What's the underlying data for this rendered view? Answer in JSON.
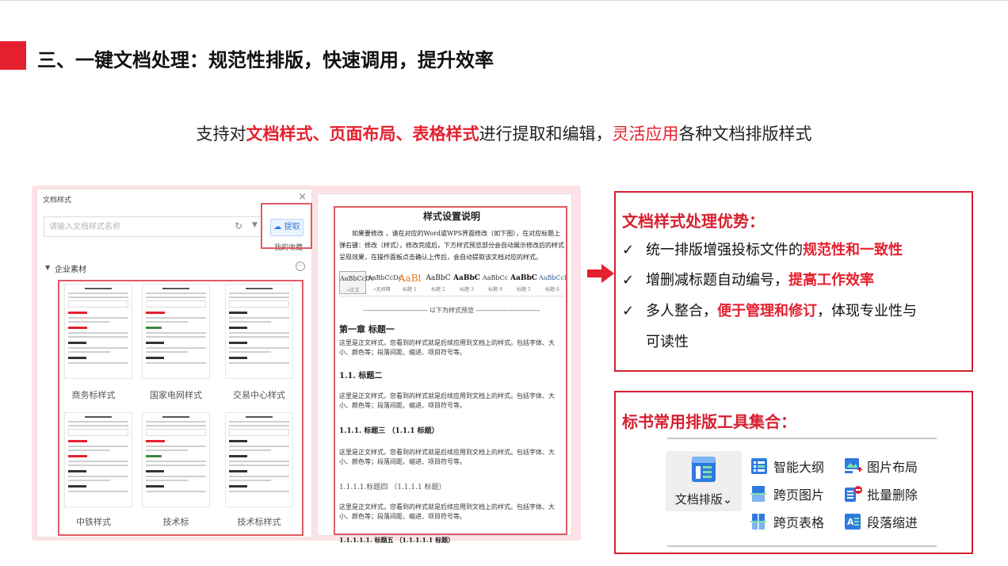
{
  "slide": {
    "title": "三、一键文档处理：规范性排版，快速调用，提升效率"
  },
  "subtitle": {
    "p1": "支持对",
    "h1": "文档样式、页面布局、表格样式",
    "p2": "进行提取和编辑，",
    "h2": "灵活应用",
    "p3": "各种文档排版样式"
  },
  "dialog": {
    "title": "文档样式",
    "close": "×",
    "search_placeholder": "请输入文档样式名称",
    "extract_label": "提取",
    "my_favorites": "我的收藏",
    "group_label": "企业素材",
    "more": "···",
    "templates": [
      {
        "label": "商务标样式"
      },
      {
        "label": "国家电网样式"
      },
      {
        "label": "交易中心样式"
      },
      {
        "label": "中铁样式"
      },
      {
        "label": "技术标"
      },
      {
        "label": "技术标样式"
      }
    ]
  },
  "doc": {
    "title": "样式设置说明",
    "intro": "如果要修改 ，请在对应的Word或WPS界面修改（如下图），在对应标题上弹右键：修改（样式），修改完成后，下方样式预览部分会自动展示修改后的样式呈现效果，在操作面板点击确认上传后，会自动提取该文档对应的样式。",
    "styles": [
      {
        "sample": "AaBbCcDc",
        "name": "↵正文"
      },
      {
        "sample": "AaBbCcDc",
        "name": "↵无间隔"
      },
      {
        "sample": "AaBl",
        "name": "标题 1"
      },
      {
        "sample": "AaBbC",
        "name": "标题 2"
      },
      {
        "sample": "AaBbC",
        "name": "标题 3"
      },
      {
        "sample": "AaBbCc",
        "name": "标题 4"
      },
      {
        "sample": "AaBbC",
        "name": "标题 5"
      },
      {
        "sample": "AaBbCcI",
        "name": "标题 6"
      }
    ],
    "divider": "------------------------------ 以下为样式预览 ------------------------------",
    "h1": "第一章  标题一",
    "body": "这里是正文样式，您看到的样式就是后续应用到文档上的样式。包括字体、大小、颜色等；段落间距、缩进、项目符号等。",
    "h2": "1.1. 标题二",
    "h3": "1.1.1.  标题三   （1.1.1  标题）",
    "h4": "1.1.1.1.标题四    （1.1.1.1  标题）",
    "h5": "1.1.1.1.1.  标题五    （1.1.1.1.1  标题）"
  },
  "advantages": {
    "title": "文档样式处理优势：",
    "check": "✓",
    "items": [
      {
        "pre": "统一排版增强投标文件的",
        "hl": "规范性和一致性",
        "post": ""
      },
      {
        "pre": "增删减标题自动编号，",
        "hl": "提高工作效率",
        "post": ""
      },
      {
        "pre": "多人整合，",
        "hl": "便于管理和修订",
        "post": "，体现专业性与"
      }
    ],
    "continuation": "可读性"
  },
  "tools": {
    "title": "标书常用排版工具集合：",
    "main_tool": "文档排版",
    "main_tool_caret": "⌄",
    "list": [
      {
        "label": "智能大纲",
        "icon": "outline-icon"
      },
      {
        "label": "图片布局",
        "icon": "image-layout-icon"
      },
      {
        "label": "跨页图片",
        "icon": "cross-page-image-icon"
      },
      {
        "label": "批量删除",
        "icon": "batch-delete-icon"
      },
      {
        "label": "跨页表格",
        "icon": "cross-page-table-icon"
      },
      {
        "label": "段落缩进",
        "icon": "paragraph-indent-icon"
      }
    ]
  },
  "colors": {
    "accent_red": "#e5202e",
    "box_red": "#d62030",
    "icon_blue": "#2f7ae0"
  }
}
